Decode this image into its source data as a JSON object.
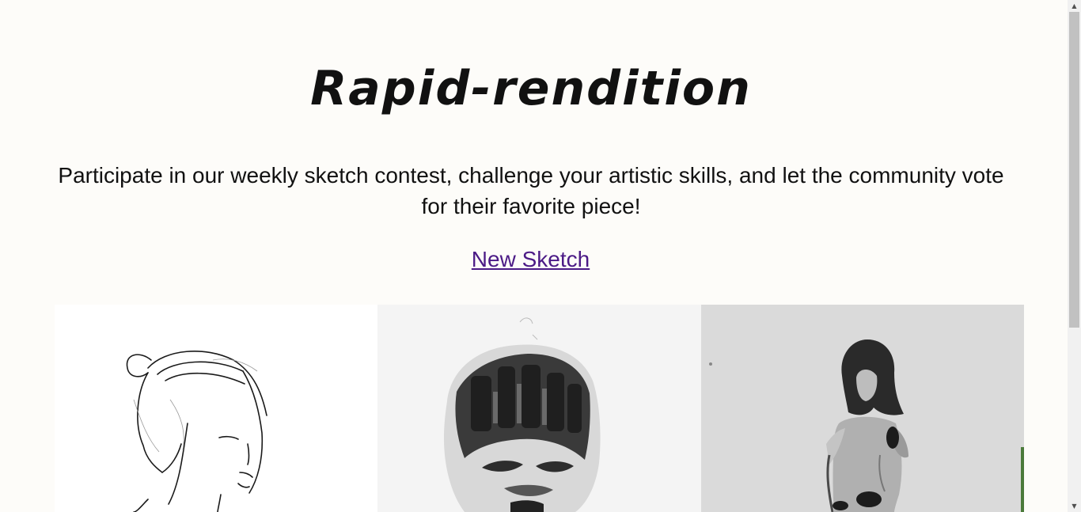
{
  "header": {
    "title": "Rapid-rendition"
  },
  "intro": {
    "tagline": "Participate in our weekly sketch contest, challenge your artistic skills, and let the community vote for their favorite piece!"
  },
  "actions": {
    "new_sketch_label": "New Sketch"
  },
  "gallery": {
    "items": [
      {
        "subject": "line sketch of a woman with hair bun"
      },
      {
        "subject": "charcoal sketch of a head with dark hair"
      },
      {
        "subject": "ink wash figure on gray paper"
      }
    ]
  },
  "colors": {
    "background": "#fdfcf9",
    "link": "#4b1a86",
    "text": "#111111"
  },
  "scrollbar": {
    "up_icon": "arrow-up-icon",
    "down_icon": "arrow-down-icon"
  }
}
